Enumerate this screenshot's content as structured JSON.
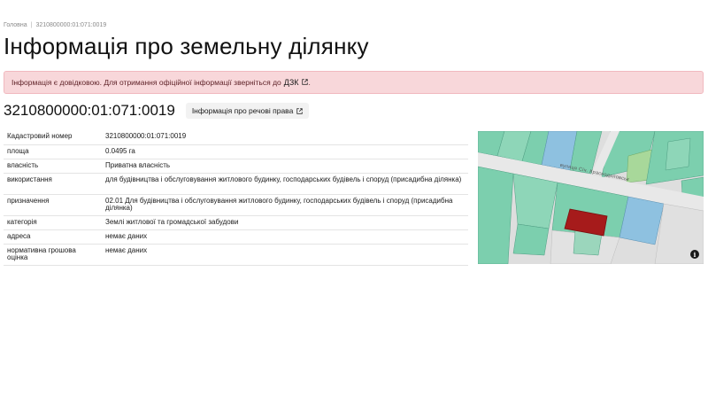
{
  "breadcrumb": {
    "home": "Головна",
    "separator": "|",
    "current": "3210800000:01:071:0019"
  },
  "page_title": "Інформація про земельну ділянку",
  "alert": {
    "text": "Інформація є довідковою. Для отримання офіційної інформації зверніться до",
    "link_label": "ДЗК",
    "suffix": ".",
    "link_icon": "external-link-icon"
  },
  "cadastral_heading": "3210800000:01:071:0019",
  "rights_button": {
    "label": "Інформація про речові права",
    "icon": "external-link-icon"
  },
  "details": [
    {
      "key": "Кадастровий номер",
      "value": "3210800000:01:071:0019"
    },
    {
      "key": "площа",
      "value": "0.0495 га"
    },
    {
      "key": "власність",
      "value": "Приватна власність"
    },
    {
      "key": "використання",
      "value": "для будівництва і обслуговування житлового будинку, господарських будівель і споруд (присадибна ділянка)"
    },
    {
      "key": "призначення",
      "value": "02.01 Для будівництва і обслуговування житлового будинку, господарських будівель і споруд (присадибна ділянка)"
    },
    {
      "key": "категорія",
      "value": "Землі житлової та громадської забудови"
    },
    {
      "key": "адреса",
      "value": "немає даних"
    },
    {
      "key": "нормативна грошова оцінка",
      "value": "немає даних"
    }
  ],
  "map": {
    "street_label": "вулиця Січ. Краснодоловськ",
    "info_icon": "info-icon",
    "info_glyph": "i",
    "colors": {
      "parcel_highlight": "#a61b1b",
      "parcel_green": "#7ccfae",
      "parcel_blue": "#8ec1e0",
      "road": "#e6e6e6"
    }
  }
}
